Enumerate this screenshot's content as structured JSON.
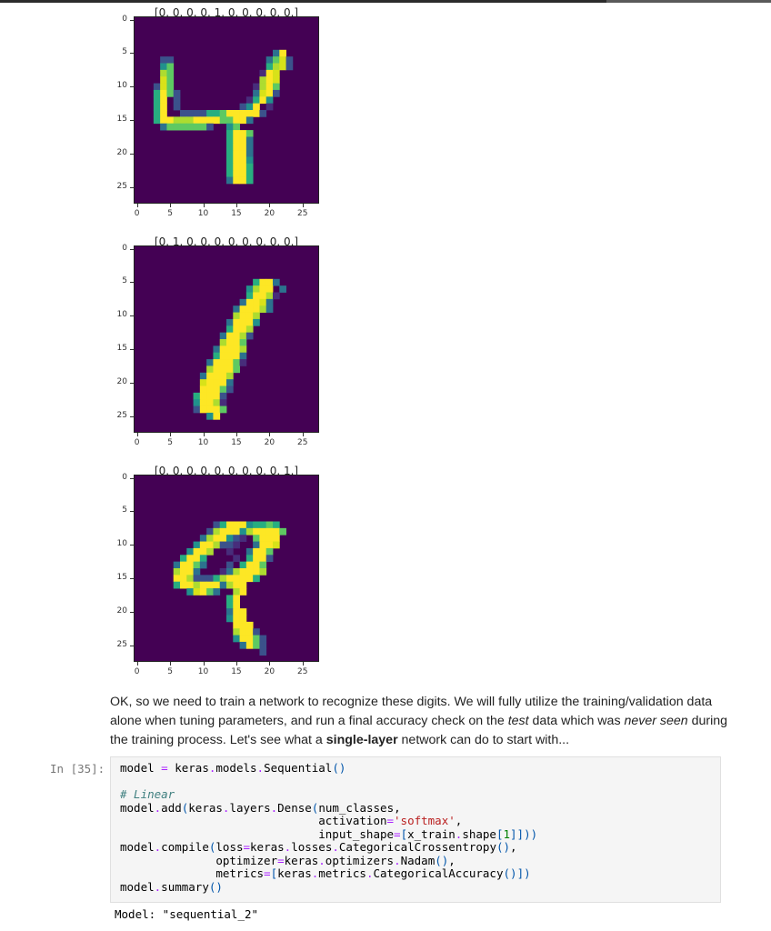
{
  "figures": [
    {
      "title": "[0. 0. 0. 0. 1. 0. 0. 0. 0. 0.]",
      "digit_label": "4",
      "yticks": [
        "0",
        "5",
        "10",
        "15",
        "20",
        "25"
      ],
      "xticks": [
        "0",
        "5",
        "10",
        "15",
        "20",
        "25"
      ],
      "colormap": "viridis",
      "pixels": [
        "............................",
        "............................",
        "............................",
        "............................",
        "............................",
        ".....................39.....",
        "....22..............36:2....",
        "....46..............57:2....",
        "....76.............198......",
        "....86.............798......",
        "...286............1796......",
        "...5962...........3892......",
        "...59.2..........1594.......",
        "...59.2.........249.1.......",
        "...59..2222556999992........",
        "...599777999966993..........",
        "....36666662..46............",
        "..............5996..........",
        "..............5993..........",
        "..............5993..........",
        "..............5993..........",
        "..............5994..........",
        "..............5995..........",
        "..............5995..........",
        "..............3995..........",
        "............................",
        "............................",
        "............................"
      ]
    },
    {
      "title": "[0. 1. 0. 0. 0. 0. 0. 0. 0. 0.]",
      "digit_label": "1",
      "yticks": [
        "0",
        "5",
        "10",
        "15",
        "20",
        "25"
      ],
      "xticks": [
        "0",
        "5",
        "10",
        "15",
        "20",
        "25"
      ],
      "colormap": "viridis",
      "pixels": [
        "............................",
        "............................",
        "............................",
        "............................",
        "............................",
        "..................5993......",
        ".................4799.3.....",
        ".................59971......",
        "................39983.......",
        "...............399973.......",
        "...............7997.........",
        "..............39994.........",
        "..............5997..........",
        ".............39972..........",
        ".............7996...........",
        "............39997...........",
        "............59993...........",
        "...........399961...........",
        "...........79996............",
        "..........39997.............",
        "..........89993.............",
        "..........99962.............",
        ".........59992..............",
        ".........49971..............",
        ".........29996..............",
        "...........49...............",
        "............................",
        "............................"
      ]
    },
    {
      "title": "[0. 0. 0. 0. 0. 0. 0. 0. 0. 1.]",
      "digit_label": "9",
      "yticks": [
        "0",
        "5",
        "10",
        "15",
        "20",
        "25"
      ],
      "xticks": [
        "0",
        "5",
        "10",
        "15",
        "20",
        "25"
      ],
      "colormap": "viridis",
      "pixels": [
        "............................",
        "............................",
        "............................",
        "............................",
        "............................",
        "............................",
        "............................",
        "............2599945565......",
        "...........279994799996.....",
        "..........3799421.6999......",
        ".........4997221..3998......",
        "........4997..1..3996.......",
        ".......5995....1.5992.......",
        "......39963...2.5996........",
        "......7993...1379997........",
        "......9972225799995.........",
        "......59979993799...........",
        "........48963..79...........",
        "..............59............",
        "..............59............",
        "..............399...........",
        "..............499...........",
        "...............999..........",
        "...............7992.........",
        "...............49962........",
        "................3962........",
        "...................2........",
        "............................"
      ]
    }
  ],
  "markdown": {
    "segments": [
      {
        "text": "OK, so we need to train a network to recognize these digits. We will fully utilize the training/validation data alone when tuning parameters, and run a final accuracy check on the ",
        "style": "normal"
      },
      {
        "text": "test",
        "style": "italic"
      },
      {
        "text": " data which was ",
        "style": "normal"
      },
      {
        "text": "never seen",
        "style": "italic"
      },
      {
        "text": " during the training process. Let's see what a ",
        "style": "normal"
      },
      {
        "text": "single-layer",
        "style": "bold"
      },
      {
        "text": " network can do to start with...",
        "style": "normal"
      }
    ]
  },
  "code_cell": {
    "prompt": "In [35]:",
    "lines": [
      "model = keras.models.Sequential()",
      "",
      "# Linear",
      "model.add(keras.layers.Dense(num_classes,",
      "                             activation='softmax',",
      "                             input_shape=[x_train.shape[1]]))",
      "model.compile(loss=keras.losses.CategoricalCrossentropy(),",
      "              optimizer=keras.optimizers.Nadam(),",
      "              metrics=[keras.metrics.CategoricalAccuracy()])",
      "model.summary()"
    ]
  },
  "output": {
    "text": "Model: \"sequential_2\""
  },
  "colors": {
    "background_cell": "#440154",
    "code_bg": "#f5f5f5",
    "prompt": "#777777"
  }
}
